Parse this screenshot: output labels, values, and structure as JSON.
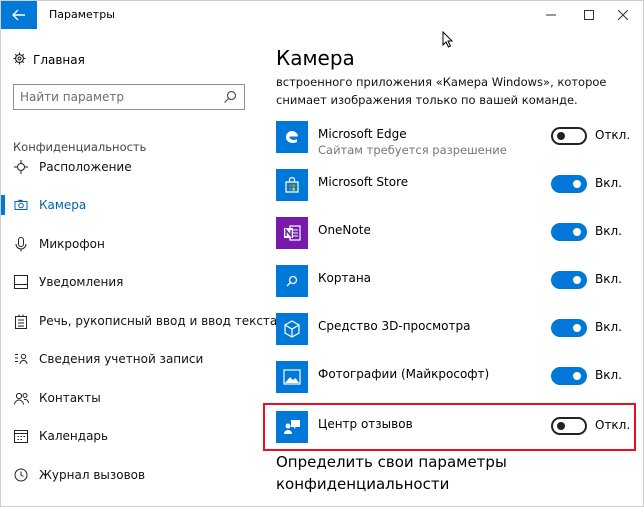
{
  "window": {
    "title": "Параметры",
    "back_icon": "back-arrow-icon",
    "minimize_glyph": "—",
    "maximize_glyph": "☐",
    "close_glyph": "✕"
  },
  "sidebar": {
    "home_label": "Главная",
    "search_placeholder": "Найти параметр",
    "section_title": "Конфиденциальность",
    "items": [
      {
        "label": "Расположение",
        "icon": "location-icon"
      },
      {
        "label": "Камера",
        "icon": "camera-icon",
        "active": true
      },
      {
        "label": "Микрофон",
        "icon": "microphone-icon"
      },
      {
        "label": "Уведомления",
        "icon": "notification-icon"
      },
      {
        "label": "Речь, рукописный ввод и ввод текста",
        "icon": "speech-icon"
      },
      {
        "label": "Сведения учетной записи",
        "icon": "account-info-icon"
      },
      {
        "label": "Контакты",
        "icon": "contacts-icon"
      },
      {
        "label": "Календарь",
        "icon": "calendar-icon"
      },
      {
        "label": "Журнал вызовов",
        "icon": "call-history-icon"
      }
    ]
  },
  "main": {
    "page_title": "Камера",
    "description_line1": "встроенного приложения «Камера Windows», которое",
    "description_line2": "снимает изображения только по вашей команде.",
    "apps": [
      {
        "name": "Microsoft Edge",
        "subtitle": "Сайтам требуется разрешение",
        "state": "off",
        "state_label": "Откл.",
        "icon": "edge-icon",
        "icon_color": "#0078d7"
      },
      {
        "name": "Microsoft Store",
        "subtitle": "",
        "state": "on",
        "state_label": "Вкл.",
        "icon": "store-icon",
        "icon_color": "#0078d7"
      },
      {
        "name": "OneNote",
        "subtitle": "",
        "state": "on",
        "state_label": "Вкл.",
        "icon": "onenote-icon",
        "icon_color": "#7719aa"
      },
      {
        "name": "Кортана",
        "subtitle": "",
        "state": "on",
        "state_label": "Вкл.",
        "icon": "cortana-icon",
        "icon_color": "#0078d7"
      },
      {
        "name": "Средство 3D-просмотра",
        "subtitle": "",
        "state": "on",
        "state_label": "Вкл.",
        "icon": "3d-viewer-icon",
        "icon_color": "#0078d7"
      },
      {
        "name": "Фотографии (Майкрософт)",
        "subtitle": "",
        "state": "on",
        "state_label": "Вкл.",
        "icon": "photos-icon",
        "icon_color": "#0078d7"
      },
      {
        "name": "Центр отзывов",
        "subtitle": "",
        "state": "off",
        "state_label": "Откл.",
        "icon": "feedback-hub-icon",
        "icon_color": "#0078d7",
        "highlighted": true
      }
    ],
    "section_heading_line1": "Определить свои параметры",
    "section_heading_line2": "конфиденциальности"
  },
  "colors": {
    "accent": "#0078d7",
    "highlight_border": "#e81123",
    "onenote": "#7719aa"
  }
}
